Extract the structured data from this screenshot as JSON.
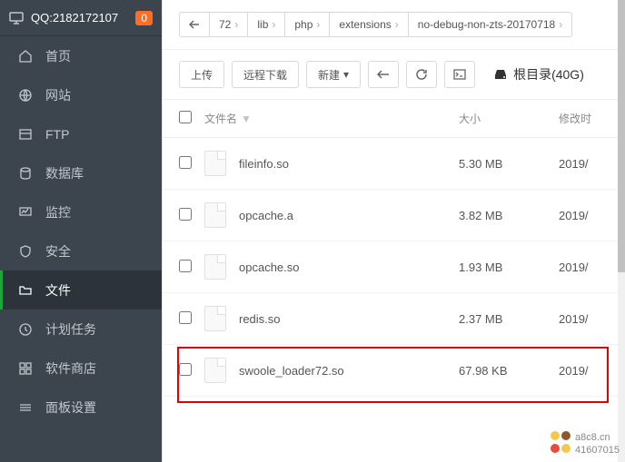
{
  "header": {
    "qq": "QQ:2182172107",
    "badge": "0"
  },
  "sidebar": {
    "items": [
      {
        "label": "首页",
        "icon": "home-icon"
      },
      {
        "label": "网站",
        "icon": "globe-icon"
      },
      {
        "label": "FTP",
        "icon": "ftp-icon"
      },
      {
        "label": "数据库",
        "icon": "database-icon"
      },
      {
        "label": "监控",
        "icon": "monitor-icon"
      },
      {
        "label": "安全",
        "icon": "shield-icon"
      },
      {
        "label": "文件",
        "icon": "folder-icon"
      },
      {
        "label": "计划任务",
        "icon": "clock-icon"
      },
      {
        "label": "软件商店",
        "icon": "store-icon"
      },
      {
        "label": "面板设置",
        "icon": "settings-icon"
      }
    ]
  },
  "breadcrumb": [
    "72",
    "lib",
    "php",
    "extensions",
    "no-debug-non-zts-20170718"
  ],
  "toolbar": {
    "upload": "上传",
    "remote": "远程下载",
    "new": "新建",
    "root": "根目录(40G)"
  },
  "table": {
    "headers": {
      "name": "文件名",
      "size": "大小",
      "date": "修改时"
    },
    "rows": [
      {
        "name": "fileinfo.so",
        "size": "5.30 MB",
        "date": "2019/"
      },
      {
        "name": "opcache.a",
        "size": "3.82 MB",
        "date": "2019/"
      },
      {
        "name": "opcache.so",
        "size": "1.93 MB",
        "date": "2019/"
      },
      {
        "name": "redis.so",
        "size": "2.37 MB",
        "date": "2019/"
      },
      {
        "name": "swoole_loader72.so",
        "size": "67.98 KB",
        "date": "2019/"
      }
    ]
  },
  "watermark": {
    "line1": "a8c8.cn",
    "line2": "41607015"
  }
}
